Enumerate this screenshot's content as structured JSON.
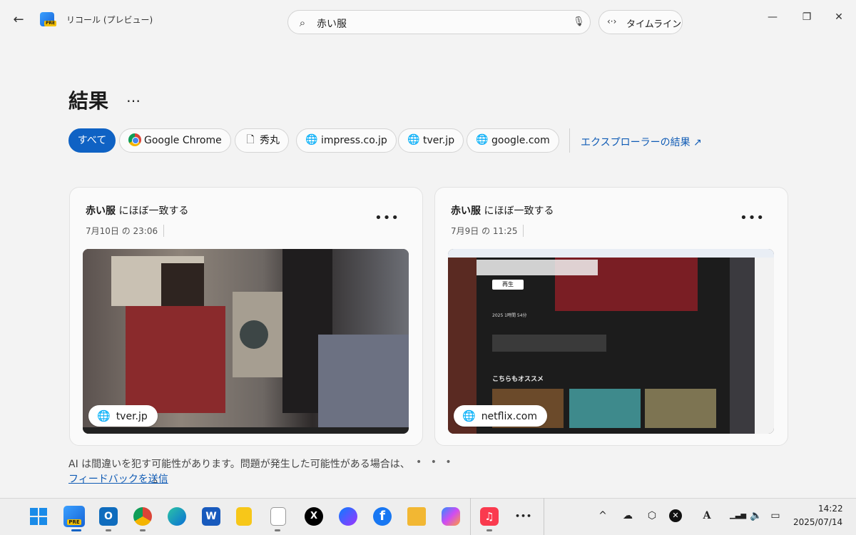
{
  "titlebar": {
    "back_icon": "back-arrow-icon",
    "app_icon": "recall-app-icon",
    "app_icon_badge": "PRE",
    "app_title": "リコール (プレビュー)",
    "search": {
      "icon": "search-sparkle-icon",
      "value": "赤い服",
      "mic_icon": "microphone-icon"
    },
    "timeline_button": {
      "icon": "timeline-icon",
      "label": "タイムライン"
    },
    "window_controls": {
      "minimize": "—",
      "maximize": "❐",
      "close": "✕"
    }
  },
  "header": {
    "title": "結果",
    "more": "…"
  },
  "filters": {
    "chips": [
      {
        "label": "すべて",
        "active": true
      },
      {
        "label": "Google Chrome",
        "icon": "chrome-icon"
      },
      {
        "label": "秀丸",
        "icon": "document-icon"
      },
      {
        "label": "impress.co.jp",
        "icon": "globe-icon"
      },
      {
        "label": "tver.jp",
        "icon": "globe-icon"
      },
      {
        "label": "google.com",
        "icon": "globe-icon"
      }
    ],
    "explorer_link": "エクスプローラーの結果 ↗"
  },
  "results": [
    {
      "match_term": "赤い服",
      "match_suffix": " にほぼ一致する",
      "time": "7月10日 の 23:06",
      "source": "tver.jp"
    },
    {
      "match_term": "赤い服",
      "match_suffix": " にほぼ一致する",
      "time": "7月9日 の 11:25",
      "source": "netflix.com"
    }
  ],
  "netflix_thumb": {
    "play": "再生",
    "meta": "2025 1時間 54分",
    "section": "こちらもオススメ"
  },
  "footer": {
    "disclaimer": "AI は間違いを犯す可能性があります。問題が発生した可能性がある場合は、",
    "feedback_link": "フィードバックを送信",
    "feedback_suffix": "。",
    "pager": "• • •"
  },
  "taskbar": {
    "apps": [
      {
        "name": "start",
        "label": ""
      },
      {
        "name": "recall",
        "label": "PRE"
      },
      {
        "name": "outlook",
        "label": "O"
      },
      {
        "name": "chrome",
        "label": ""
      },
      {
        "name": "edge",
        "label": ""
      },
      {
        "name": "word",
        "label": "W"
      },
      {
        "name": "sticky-notes",
        "label": ""
      },
      {
        "name": "notepad",
        "label": ""
      },
      {
        "name": "x",
        "label": "X"
      },
      {
        "name": "messenger",
        "label": ""
      },
      {
        "name": "facebook",
        "label": "f"
      },
      {
        "name": "file-explorer",
        "label": ""
      },
      {
        "name": "copilot",
        "label": ""
      },
      {
        "name": "apple-music",
        "label": "♫"
      },
      {
        "name": "overflow",
        "label": "•••"
      }
    ],
    "tray": {
      "chevron": "^",
      "wifi_label": "▁▃▅",
      "volume": "🔈",
      "battery": "▭"
    },
    "clock": {
      "time": "14:22",
      "date": "2025/07/14"
    }
  }
}
